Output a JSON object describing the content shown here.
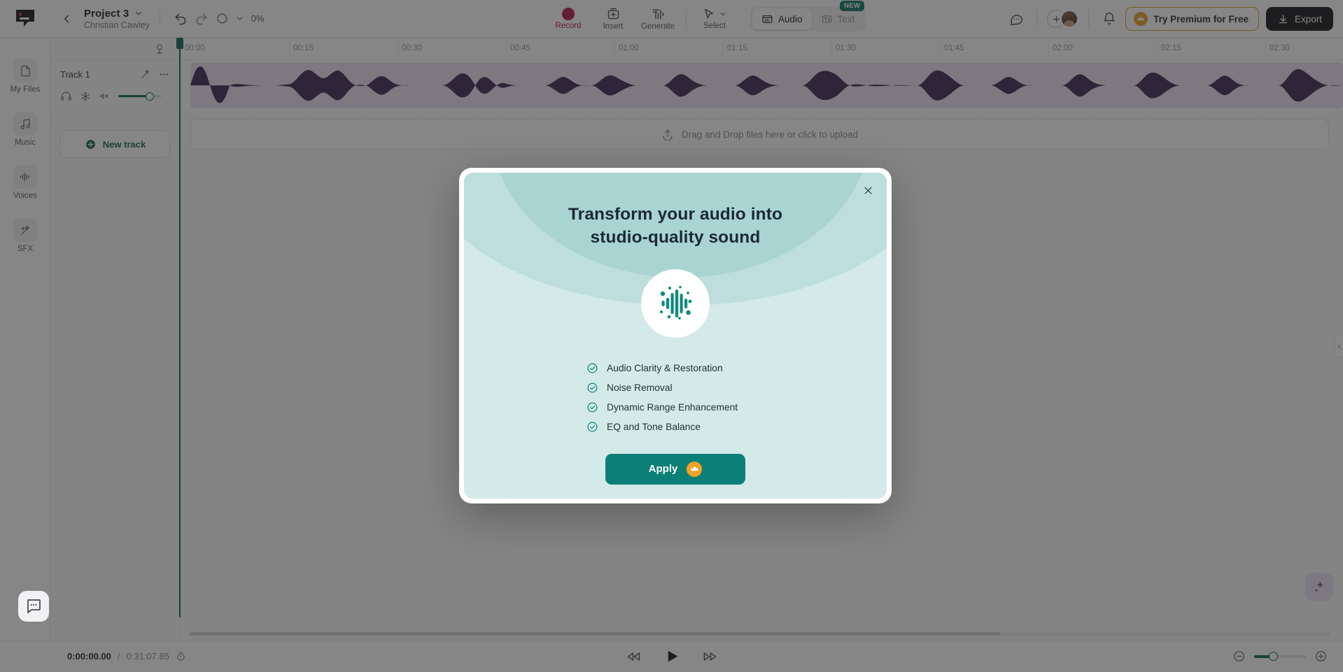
{
  "app": {
    "logo": "rec-logo-icon"
  },
  "topbar": {
    "back_icon": "chevron-left-icon",
    "project_name": "Project 3",
    "project_chevron": "chevron-down-icon",
    "project_owner": "Christian Cawley",
    "undo_icon": "undo-icon",
    "redo_icon": "redo-icon",
    "speed_icon": "speed-circle-icon",
    "speed_chevron": "chevron-down-icon",
    "speed_value": "0%",
    "tools": [
      {
        "label": "Record",
        "icon": "record-dot-icon"
      },
      {
        "label": "Insert",
        "icon": "insert-box-icon"
      },
      {
        "label": "Generate",
        "icon": "generate-bars-icon"
      },
      {
        "label": "Select",
        "icon": "cursor-arrow-icon"
      }
    ],
    "mode_tabs": [
      {
        "label": "Audio",
        "icon": "audio-panel-icon",
        "active": true
      },
      {
        "label": "Text",
        "icon": "text-box-icon",
        "active": false
      }
    ],
    "new_badge": "NEW",
    "comment_icon": "comment-icon",
    "add_member_icon": "plus-icon",
    "avatar": "user-avatar",
    "bell_icon": "bell-icon",
    "premium_label": "Try Premium for Free",
    "premium_icon": "crown-icon",
    "export_label": "Export",
    "export_icon": "download-icon"
  },
  "rail": {
    "items": [
      {
        "label": "My Files",
        "icon": "file-icon"
      },
      {
        "label": "Music",
        "icon": "music-note-icon"
      },
      {
        "label": "Voices",
        "icon": "voice-waveform-icon"
      },
      {
        "label": "SFX",
        "icon": "sfx-wand-icon"
      }
    ]
  },
  "track_panel": {
    "pin_icon": "pin-marker-icon",
    "tracks": [
      {
        "name": "Track 1",
        "enhance_icon": "magic-wand-icon",
        "more_icon": "more-dots-icon",
        "solo_icon": "headphones-icon",
        "freeze_icon": "snowflake-icon",
        "mute_icon": "speaker-mute-icon",
        "volume_percent": 75
      }
    ],
    "new_track_label": "New track",
    "new_track_icon": "plus-circle-icon"
  },
  "timeline": {
    "ticks": [
      "00:00",
      "00:15",
      "00:30",
      "00:45",
      "01:00",
      "01:15",
      "01:30",
      "01:45",
      "02:00",
      "02:15",
      "02:30"
    ],
    "dropzone_label": "Drag and Drop files here or click to upload",
    "dropzone_icon": "upload-icon",
    "waveform_color": "#3c2a52",
    "clip_bg": "#e9e4f2",
    "playhead_color": "#14645a"
  },
  "bottombar": {
    "current_time": "0:00:00.00",
    "separator": "/",
    "total_time": "0:31:07.85",
    "timer_icon": "stopwatch-icon",
    "rewind_icon": "rewind-icon",
    "play_icon": "play-icon",
    "forward_icon": "fast-forward-icon",
    "zoom_out_icon": "minus-circle-icon",
    "zoom_in_icon": "plus-circle-icon",
    "zoom_percent": 35
  },
  "helpers": {
    "intercom_icon": "intercom-chat-icon",
    "ai_fab_icon": "sparkle-icon",
    "collapse_icon": "chevron-left-icon"
  },
  "modal": {
    "close_icon": "close-icon",
    "title_line1": "Transform your audio into",
    "title_line2": "studio-quality sound",
    "orb_icon": "audio-waveform-icon",
    "features": [
      {
        "label": "Audio Clarity & Restoration",
        "icon": "check-circle-icon"
      },
      {
        "label": "Noise Removal",
        "icon": "check-circle-icon"
      },
      {
        "label": "Dynamic Range Enhancement",
        "icon": "check-circle-icon"
      },
      {
        "label": "EQ and Tone Balance",
        "icon": "check-circle-icon"
      }
    ],
    "apply_label": "Apply",
    "apply_icon": "crown-icon",
    "accent_color": "#0c8077",
    "bg_color": "#d4eae8",
    "crown_color": "#f2a127"
  }
}
